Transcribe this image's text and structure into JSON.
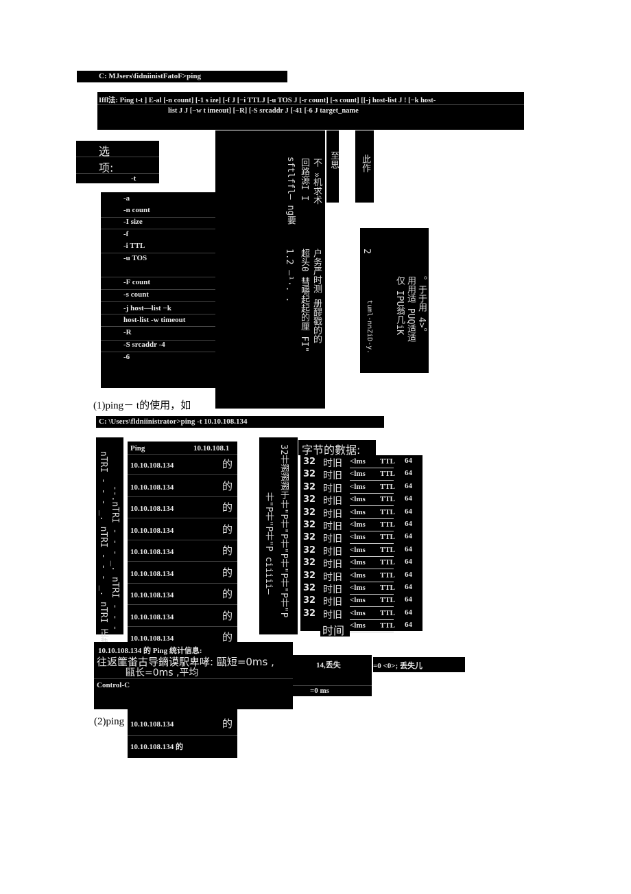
{
  "cmd1": "C: MJsers\\fidniinistFatoF>ping",
  "usage": {
    "line1": "Iffl法: Ping t-t ] E-al [-n count] [-1 s ize] [-f J [−i TTLJ [-u TOS J [-r count] [-s count] [[-j host-list J ! [−k host-",
    "line2": "list J J [−w t imeout] [−R] [-S srcaddr J [-41 [-6 J target_name"
  },
  "options_header": [
    "选",
    "项:",
    "-t"
  ],
  "options": [
    "-a",
    "-n count",
    "-I size",
    "-f",
    "-i TTL",
    "-u TOS",
    "-F count",
    "-s count",
    "-j host—list −k",
    "host-list -w timeout",
    "-R",
    "-S srcaddr -4",
    "-6"
  ],
  "vertical_cols": [
    "至思",
    "此作",
    "不 »机求术",
    "回路源I I",
    "sftlffl— ng要",
    "户务严时测 册醪戳的的",
    "超头0 彗嚼起起的厘 FI\"",
    "1.2 —¹·. .",
    "2",
    "。于于用 4>。",
    "用用适 PUQ适适",
    "仅 IPU翁几iK",
    "tuml-nnZiD-y."
  ],
  "para1": "(1)ping－ t的使用，如",
  "cmd2": "C:   \\Users\\fldniinistrator>ping -t 10.10.108.134",
  "left_vertical": [
    "nTRI - - - _. nTRI - - - _. nTRI 正#",
    "--.nTRI - - - _. nTRI - - -"
  ],
  "ping_header": {
    "label": "Ping",
    "ip": "10.10.108.1"
  },
  "ping_rows": [
    "10.10.108.134",
    "10.10.108.134",
    "10.10.108.134",
    "10.10.108.134",
    "10.10.108.134",
    "10.10.108.134",
    "10.10.108.134",
    "10.10.108.134",
    "10.10.108.134"
  ],
  "ping_suffix": "的",
  "mid_vertical": [
    "32卄遡遡遡于卄\"P卄\"P卄\"P卄\"P卄\"P卄\"P",
    "卄\"P卄\"P卄\"P ciiiii—"
  ],
  "bytes_label": "字节的數据:",
  "reply": {
    "bytes": "32",
    "time_label": "时旧",
    "time": "<lms",
    "ttl_label": "TTL",
    "ttl": "64",
    "count": 14,
    "last_time_label": "时间"
  },
  "stats": {
    "title": "10.10.108.134 的  Ping 统计信息:",
    "line2": "往返篚畨古导鏑谟駅卑哮:  甌短=0ms ,",
    "line3": "甌长=0ms ,平均",
    "ctrl": "Control-C",
    "lost": "14,丢失",
    "lost2": "=0 <0>;  丢失儿",
    "avg": "=0 ms"
  },
  "para2": "(2)ping",
  "ping_rows2": [
    "10.10.108.134",
    "10.10.108.134 的"
  ]
}
